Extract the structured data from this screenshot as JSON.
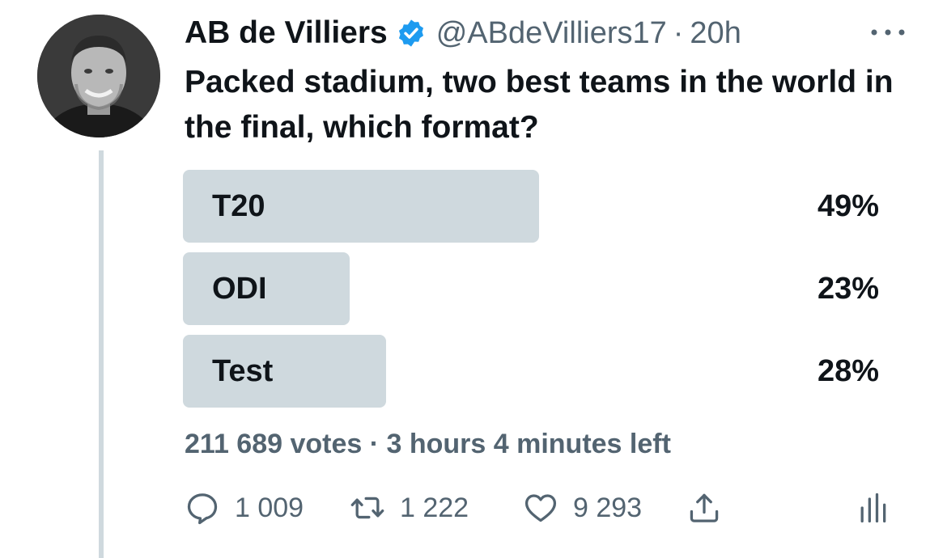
{
  "tweet": {
    "author_name": "AB de Villiers",
    "handle": "@ABdeVilliers17",
    "separator": "·",
    "time": "20h",
    "text": "Packed stadium, two best teams in the world in the final, which format?",
    "verified": true
  },
  "poll": {
    "options": [
      {
        "label": "T20",
        "percent": "49%",
        "fraction": 0.49
      },
      {
        "label": "ODI",
        "percent": "23%",
        "fraction": 0.23
      },
      {
        "label": "Test",
        "percent": "28%",
        "fraction": 0.28
      }
    ],
    "meta": "211 689 votes · 3 hours 4 minutes left"
  },
  "actions": {
    "reply_count": "1 009",
    "retweet_count": "1 222",
    "like_count": "9 293"
  },
  "icons": {
    "verified": "verified-badge-icon",
    "more": "more-horizontal-icon",
    "reply": "reply-icon",
    "retweet": "retweet-icon",
    "like": "heart-icon",
    "share": "share-icon",
    "analytics": "analytics-icon"
  },
  "colors": {
    "accent": "#1d9bf0",
    "poll_bar": "#cfd9de",
    "text_secondary": "#536471",
    "text_primary": "#0f1419"
  }
}
